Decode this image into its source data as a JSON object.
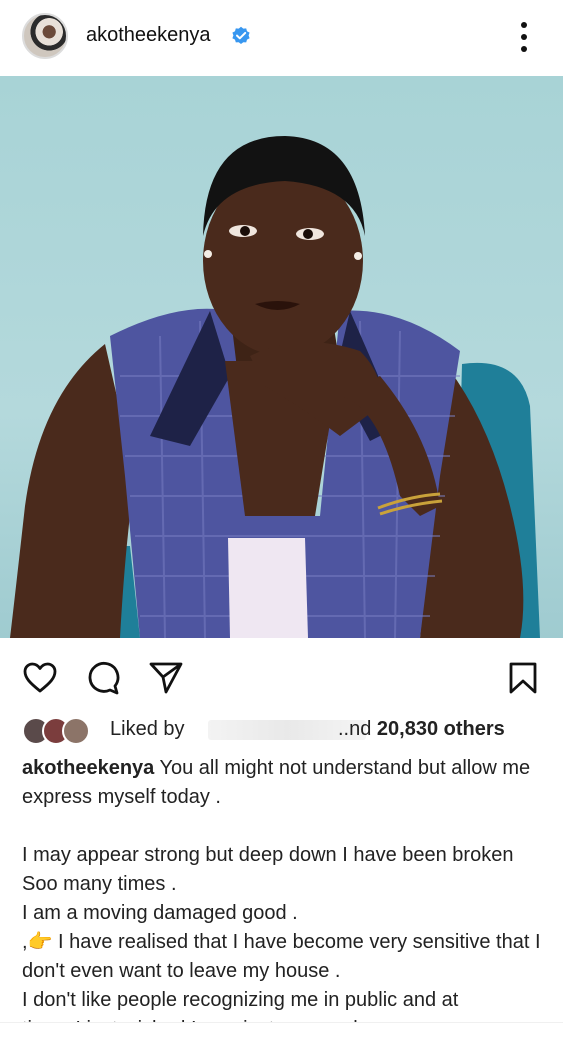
{
  "post": {
    "username": "akotheekenya",
    "verified": true,
    "accent_color": "#3897f0"
  },
  "likes": {
    "prefix": "Liked by",
    "suffix_partial": "..nd",
    "count": "20,830",
    "others": "others"
  },
  "caption": {
    "username": "akotheekenya",
    "lines": [
      "You all might not understand but allow me express myself today .",
      "",
      "I may appear strong but deep down I have been broken Soo many times .",
      "I am a moving damaged good .",
      ",👉 I have realised that I have become very sensitive that I don't even want to leave my house .",
      "I don't like people recognizing me in public and at"
    ],
    "truncated_line": "times I just wished I was just a normal person"
  },
  "icons": {
    "more": "more-vertical-icon",
    "like": "heart-icon",
    "comment": "comment-icon",
    "share": "send-icon",
    "save": "bookmark-icon",
    "verified": "verified-badge-icon"
  }
}
